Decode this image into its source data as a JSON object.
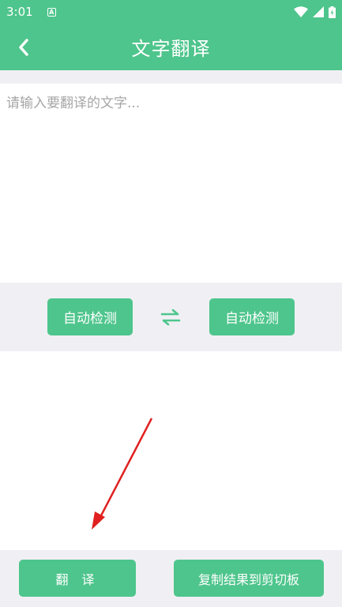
{
  "status_bar": {
    "time": "3:01",
    "app_icon_letter": "A",
    "icons": [
      "wifi-icon",
      "signal-icon",
      "battery-icon"
    ]
  },
  "app_bar": {
    "title": "文字翻译",
    "back_icon": "chevron-left-icon"
  },
  "input": {
    "placeholder": "请输入要翻译的文字...",
    "value": ""
  },
  "language_bar": {
    "source_label": "自动检测",
    "target_label": "自动检测",
    "swap_icon": "swap-arrows-icon"
  },
  "result": {
    "text": ""
  },
  "bottom_bar": {
    "translate_label": "翻 译",
    "copy_label": "复制结果到剪切板"
  },
  "colors": {
    "accent": "#4ec58c",
    "background_gray": "#f0f0f4",
    "placeholder": "#a6a6a6",
    "annotation_arrow": "#e02020"
  }
}
